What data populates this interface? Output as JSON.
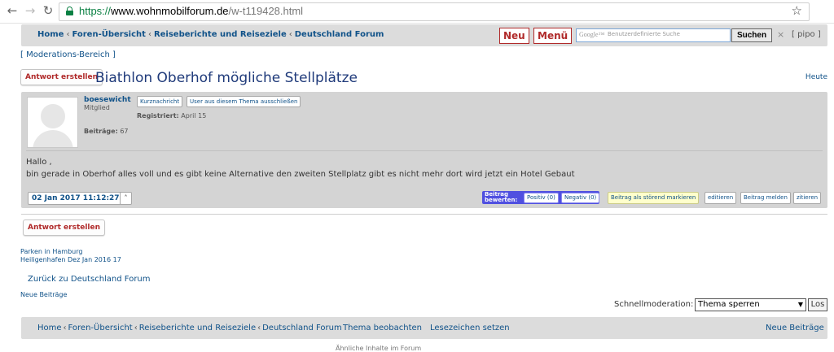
{
  "browser": {
    "url_protocol": "https://",
    "url_domain": "www.wohnmobilforum.de",
    "url_path": "/w-t119428.html"
  },
  "topnav": {
    "breadcrumb": [
      "Home",
      "Foren-Übersicht",
      "Reiseberichte und Reiseziele",
      "Deutschland Forum"
    ],
    "separator": "‹",
    "neu": "Neu",
    "menu": "Menü",
    "search_brand": "Google™",
    "search_placeholder": "Benutzerdefinierte Suche",
    "search_button": "Suchen",
    "close": "×",
    "user": "[ pipo ]"
  },
  "moderation_link": "[ Moderations-Bereich ]",
  "reply_button": "Antwort erstellen",
  "topic_title": "Biathlon Oberhof mögliche Stellplätze",
  "today_link": "Heute",
  "post": {
    "author": "boesewicht",
    "rank": "Mitglied",
    "posts_label": "Beiträge:",
    "posts_count": "67",
    "pm_button": "Kurznachricht",
    "exclude_button": "User aus diesem Thema ausschließen",
    "registered_label": "Registriert:",
    "registered_value": "April 15",
    "body_line1": "Hallo ,",
    "body_line2": "bin gerade in Oberhof alles voll und es gibt keine Alternative den zweiten Stellplatz gibt es nicht mehr dort wird jetzt ein Hotel Gebaut",
    "date": "02 Jan 2017 11:12:27",
    "up": "˄",
    "rate_label_1": "Beitrag",
    "rate_label_2": "bewerten:",
    "positive": "Positiv (0)",
    "negative": "Negativ (0)",
    "mark_disturbing": "Beitrag als störend markieren",
    "edit": "editieren",
    "report": "Beitrag melden",
    "quote": "zitieren"
  },
  "related": {
    "line1": "Parken in Hamburg",
    "line2": "Heiligenhafen Dez Jan 2016 17"
  },
  "back_link": "Zurück zu Deutschland Forum",
  "new_posts_link": "Neue Beiträge",
  "quickmod": {
    "label": "Schnellmoderation:",
    "selected": "Thema sperren",
    "go": "Los"
  },
  "bottomnav": {
    "breadcrumb": [
      "Home",
      "Foren-Übersicht",
      "Reiseberichte und Reiseziele",
      "Deutschland Forum"
    ],
    "watch": "Thema beobachten",
    "bookmark": "Lesezeichen setzen",
    "new_posts": "Neue Beiträge"
  },
  "footer_cut": "Ähnliche Inhalte im Forum"
}
